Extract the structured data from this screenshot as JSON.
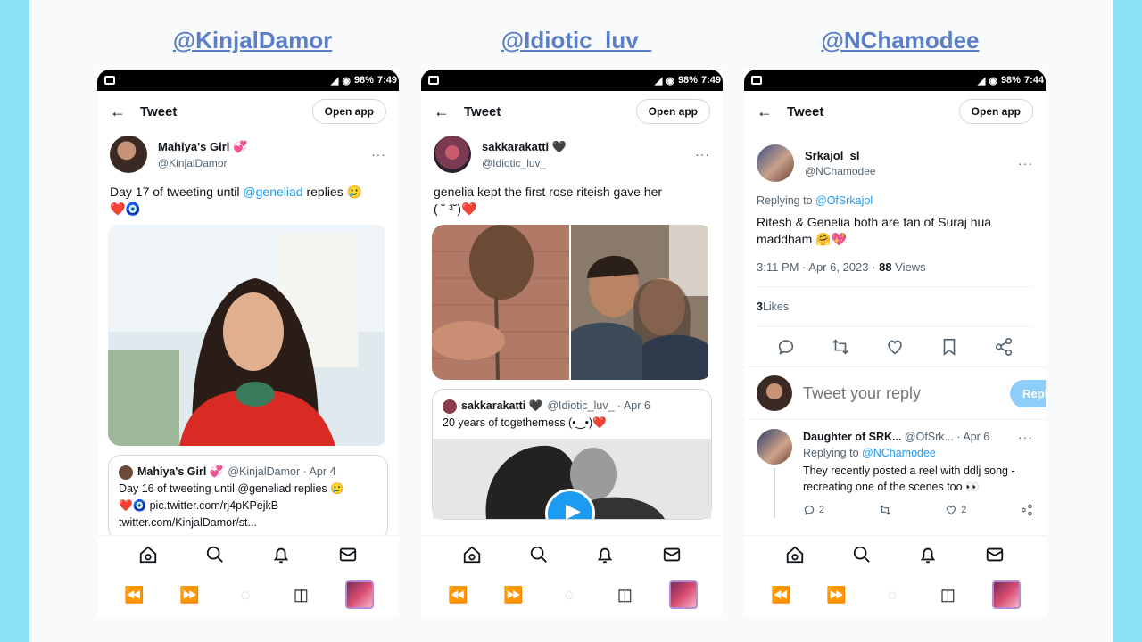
{
  "colors": {
    "accent": "#1d9bf0",
    "handle": "#5b7fc6",
    "frame": "#8ce0f7"
  },
  "handles": [
    "@KinjalDamor",
    "@Idiotic_luv_",
    "@NChamodee"
  ],
  "statusbar": [
    {
      "battery": "98%",
      "time": "7:49"
    },
    {
      "battery": "98%",
      "time": "7:49"
    },
    {
      "battery": "98%",
      "time": "7:44"
    }
  ],
  "common": {
    "title": "Tweet",
    "open_app": "Open app",
    "more": "···"
  },
  "panel1": {
    "display_name": "Mahiya's Girl 💞",
    "username": "@KinjalDamor",
    "text_before": "Day 17 of tweeting until ",
    "mention": "@geneliad",
    "text_after": " replies 🥲",
    "emojis": "❤️🧿",
    "quote": {
      "display_name": "Mahiya's Girl 💞",
      "meta": "@KinjalDamor · Apr 4",
      "line1": "Day 16 of tweeting until @geneliad replies 🥲",
      "line2": "❤️🧿 pic.twitter.com/rj4pKPejkB",
      "line3": "twitter.com/KinjalDamor/st..."
    }
  },
  "panel2": {
    "display_name": "sakkarakatti 🖤",
    "username": "@Idiotic_luv_",
    "text": "genelia kept the first rose riteish gave her",
    "text2": "( ˘ ³˘)❤️",
    "quote": {
      "display_name": "sakkarakatti 🖤",
      "meta": "@Idiotic_luv_ · Apr 6",
      "text": "20 years of togetherness (•‿•)❤️"
    }
  },
  "panel3": {
    "display_name": "Srkajol_sl",
    "username": "@NChamodee",
    "replying_prefix": "Replying to ",
    "replying_to": "@OfSrkajol",
    "text": "Ritesh & Genelia both are fan of Suraj hua maddham 🤗💖",
    "time": "3:11 PM · Apr 6, 2023 · ",
    "views_count": "88",
    "views_label": " Views",
    "likes_count": "3",
    "likes_label": " Likes",
    "reply_placeholder": "Tweet your reply",
    "reply_button": "Reply",
    "reply": {
      "display_name": "Daughter of SRK...",
      "meta": "@OfSrk... · Apr 6",
      "replying_prefix": "Replying to ",
      "replying_to": "@NChamodee",
      "text": "They recently posted a reel with ddlj song - recreating one of the scenes too 👀",
      "reply_count": "2",
      "like_count": "2"
    }
  }
}
